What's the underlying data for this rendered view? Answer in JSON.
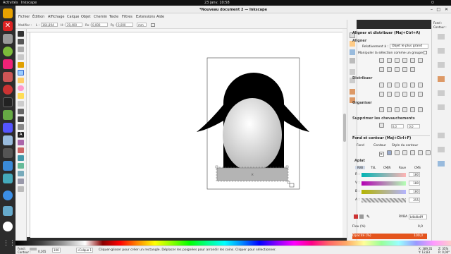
{
  "topbar": {
    "activities": "Activités",
    "app": "Inkscape",
    "clock": "23 janv.  10:58"
  },
  "window": {
    "title": "*Nouveau document 2 — Inkscape"
  },
  "menu": [
    "Fichier",
    "Édition",
    "Affichage",
    "Calque",
    "Objet",
    "Chemin",
    "Texte",
    "Filtres",
    "Extensions",
    "Aide"
  ],
  "controls": {
    "modify_label": "Modifier :",
    "w_label": "L :",
    "w_value": "164,894",
    "h_label": "H :",
    "h_value": "29,400",
    "rx_label": "Rx :",
    "rx_value": "0,000",
    "ry_label": "Ry :",
    "ry_value": "0,000",
    "unit": "mm"
  },
  "right_corner": {
    "fill_label": "Fond :",
    "stroke_label": "Contour :"
  },
  "align_panel": {
    "header": "Aligner et distribuer (Maj+Ctrl+A)",
    "align_title": "Aligner",
    "relative_label": "Relativement à :",
    "relative_value": "Objet le plus grand",
    "manipulate": "Manipuler la sélection comme un groupe :",
    "distribute_title": "Distribuer",
    "organize_title": "Organiser",
    "overlap_title": "Supprimer les chevauchements"
  },
  "fill_panel": {
    "header": "Fond et contour (Maj+Ctrl+F)",
    "tab_fill": "Fond",
    "tab_stroke": "Contour",
    "tab_style": "Style du contour",
    "flat_label": "Aplat",
    "modes": [
      "RVB",
      "TSL",
      "CMJN",
      "Roue",
      "CMS"
    ],
    "channels": [
      {
        "label": "R :",
        "value": "180"
      },
      {
        "label": "V :",
        "value": "180"
      },
      {
        "label": "B :",
        "value": "180"
      },
      {
        "label": "A :",
        "value": "255"
      }
    ],
    "rgba_label": "RVBA :",
    "rgba_value": "b4b4b4ff",
    "blur_label": "Flou (%)",
    "blur_value": "0,0",
    "opacity_label": "Opacité (%)",
    "opacity_value": "100,0"
  },
  "status": {
    "fill_label": "Fond :",
    "stroke_label": "Contour :",
    "stroke_width": "0,265",
    "opacity": "100",
    "layer": "•Calque 1",
    "message": "Cliquer-glisser pour créer un rectangle. Déplacer les poignées pour arrondir les coins. Cliquer pour sélectionner.",
    "x": "X:  389,35",
    "y": "Y:   12,83",
    "zoom": "Z: 35%",
    "rotation": "R: 0,00°"
  }
}
